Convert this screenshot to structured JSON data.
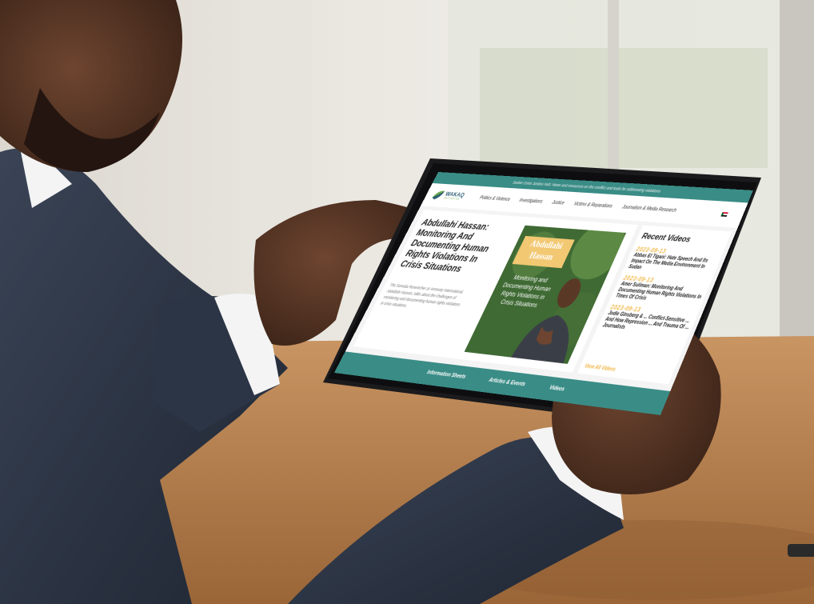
{
  "topbar": {
    "tagline": "Sudan Crisis Justice Hub: News and resources on the conflict and tools for addressing violations"
  },
  "navbar": {
    "logo_name": "WAKAQ",
    "logo_sub": "INITIATIVE",
    "items": [
      "Politics & Violence",
      "Investigations",
      "Justice",
      "Victims & Reparations",
      "Journalism & Media Research"
    ]
  },
  "feature": {
    "title": "Abdullahi Hassan: Monitoring And Documenting Human Rights Violations In Crisis Situations",
    "description": "The Somalia Researcher at Amnesty International, Abdullahi Hassan, talks about the challenges of monitoring and documenting human rights violations in crisis situations.",
    "photo_tag": "Abdullahi Hassan",
    "photo_caption": "Monitoring and Documenting Human Rights Violations in Crisis Situations"
  },
  "sidebar": {
    "title": "Recent Videos",
    "videos": [
      {
        "date": "2023-09-13",
        "title": "Abbas El Tigani: Hate Speech And Its Impact On The Media Environment In Sudan"
      },
      {
        "date": "2023-09-13",
        "title": "Amer Suliman: Monitoring And Documenting Human Rights Violations In Times Of Crisis"
      },
      {
        "date": "2023-09-13",
        "title": "Jodie Ginsberg & ... Conflict-Sensitive ... And How Repression ... And Trauma Of ... Journalists"
      }
    ],
    "view_all": "View All Videos"
  },
  "footer": {
    "items": [
      "Information Sheets",
      "Articles & Events",
      "Videos"
    ]
  },
  "colors": {
    "teal": "#3a8c86",
    "gold": "#f2c873",
    "suit": "#2a3344",
    "skin": "#5a3826",
    "table": "#b57d4a"
  }
}
